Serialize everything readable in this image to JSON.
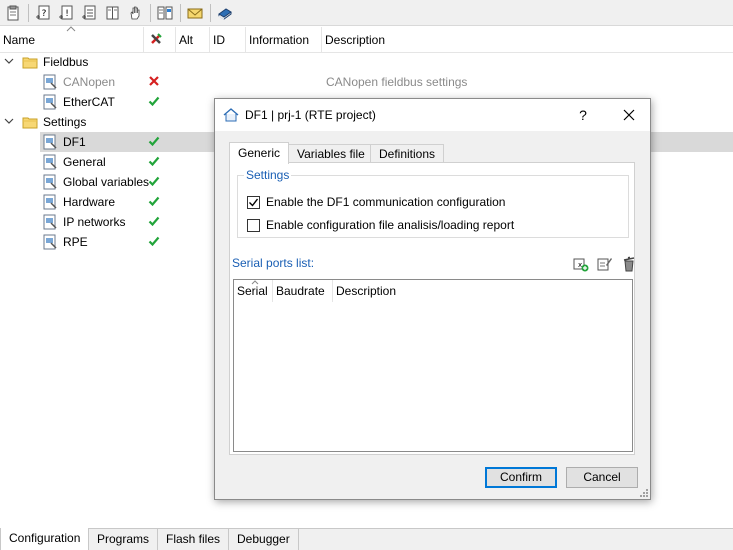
{
  "toolbar": {
    "buttons": [
      {
        "icon": "clipboard-icon"
      },
      {
        "icon": "add-question-icon"
      },
      {
        "icon": "add-exclamation-icon"
      },
      {
        "icon": "add-list-icon"
      },
      {
        "icon": "add-columns-icon"
      },
      {
        "icon": "hand-pointer-icon"
      },
      {
        "icon": "split-view-icon"
      },
      {
        "icon": "envelope-icon"
      },
      {
        "icon": "book-icon"
      }
    ]
  },
  "tree": {
    "columns": {
      "name": "Name",
      "alt": "Alt",
      "id": "ID",
      "information": "Information",
      "description": "Description"
    },
    "nodes": {
      "fieldbus": {
        "label": "Fieldbus"
      },
      "canopen": {
        "label": "CANopen",
        "status": "error",
        "description": "CANopen fieldbus settings"
      },
      "ethercat": {
        "label": "EtherCAT",
        "status": "ok"
      },
      "settings": {
        "label": "Settings"
      },
      "df1": {
        "label": "DF1",
        "status": "ok"
      },
      "general": {
        "label": "General",
        "status": "ok"
      },
      "global_variables": {
        "label": "Global variables",
        "status": "ok"
      },
      "hardware": {
        "label": "Hardware",
        "status": "ok"
      },
      "ip_networks": {
        "label": "IP networks",
        "status": "ok"
      },
      "rpe": {
        "label": "RPE",
        "status": "ok"
      }
    }
  },
  "dialog": {
    "title": "DF1 | prj-1 (RTE project)",
    "help": "?",
    "tabs": [
      "Generic",
      "Variables file",
      "Definitions"
    ],
    "active_tab": "Generic",
    "settings_group": {
      "legend": "Settings",
      "enable_df1": {
        "label": "Enable the DF1 communication configuration",
        "checked": true
      },
      "enable_report": {
        "label": "Enable configuration file analisis/loading report",
        "checked": false
      }
    },
    "serial_ports": {
      "label": "Serial ports list:",
      "columns": [
        "Serial",
        "Baudrate",
        "Description"
      ]
    },
    "confirm_label": "Confirm",
    "cancel_label": "Cancel"
  },
  "bottom_tabs": {
    "configuration": "Configuration",
    "programs": "Programs",
    "flash_files": "Flash files",
    "debugger": "Debugger"
  },
  "colors": {
    "ok": "#22a43a",
    "error": "#d62020",
    "accent": "#0078d7",
    "group_label": "#1a5fb4"
  }
}
